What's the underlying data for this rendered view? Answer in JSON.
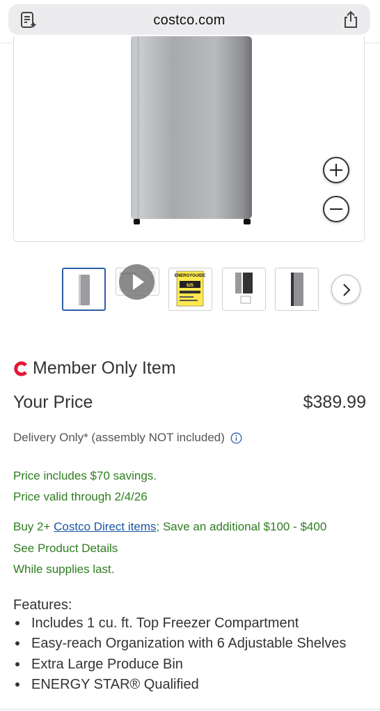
{
  "browser": {
    "url": "costco.com",
    "left_icon": "reader-icon",
    "right_icon": "share-icon"
  },
  "gallery": {
    "zoom_in_icon": "plus-icon",
    "zoom_out_icon": "minus-icon",
    "thumbnails": [
      {
        "name": "front view",
        "active": true
      },
      {
        "name": "video",
        "active": false
      },
      {
        "name": "energy guide",
        "active": false
      },
      {
        "name": "open view",
        "active": false
      },
      {
        "name": "side view",
        "active": false
      }
    ],
    "energy_guide_label": "ENERGYGUIDE",
    "energy_guide_amount": "$25",
    "next_icon": "chevron-right-icon"
  },
  "product": {
    "member_only_label": "Member Only Item",
    "price_label": "Your Price",
    "price_value": "$389.99",
    "delivery_text": "Delivery Only* (assembly NOT included)",
    "savings_text": "Price includes $70 savings.",
    "valid_through_text": "Price valid through 2/4/26",
    "promo_prefix": "Buy 2+ ",
    "promo_link": "Costco Direct items",
    "promo_suffix": "; Save an additional $100 - $400",
    "see_details": "See Product Details",
    "supplies": "While supplies last."
  },
  "features": {
    "title": "Features:",
    "items": [
      "Includes 1 cu. ft. Top Freezer Compartment",
      "Easy-reach Organization with 6 Adjustable Shelves",
      "Extra Large Produce Bin",
      "ENERGY STAR® Qualified"
    ]
  },
  "colors": {
    "brand_red": "#e31837",
    "savings_green": "#2e7d1f",
    "link_blue": "#1a55a3",
    "active_thumb": "#2a5fa8"
  }
}
